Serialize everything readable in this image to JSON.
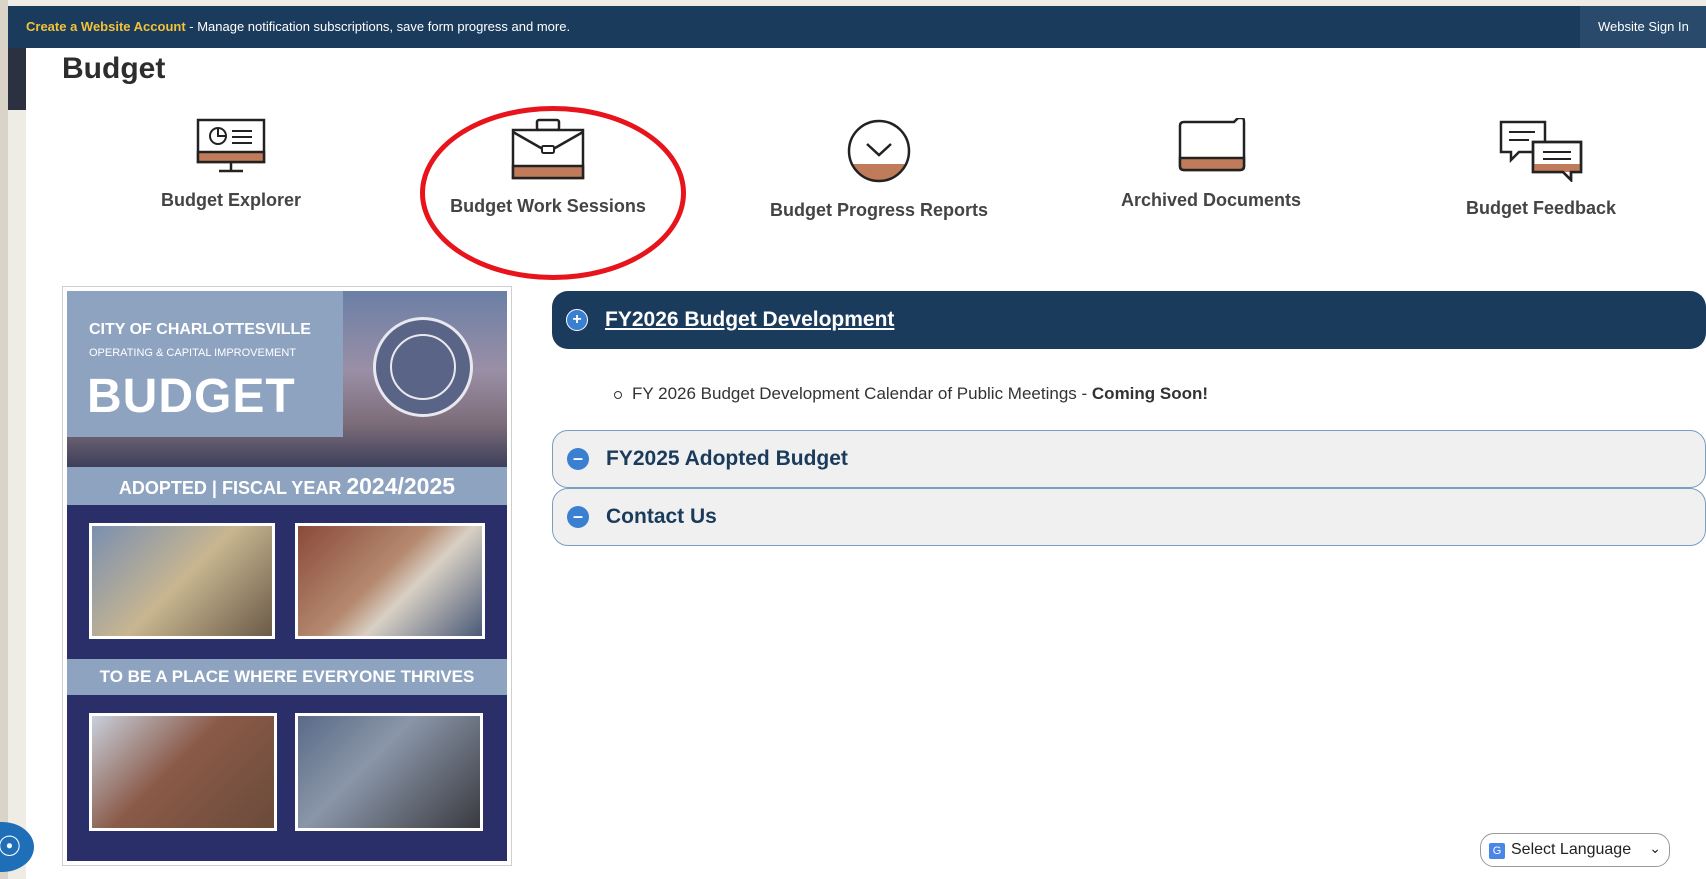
{
  "top_bar": {
    "create_account_link": "Create a Website Account",
    "message": " - Manage notification subscriptions, save form progress and more.",
    "sign_in": "Website Sign In"
  },
  "page": {
    "title": "Budget"
  },
  "nav": [
    {
      "label": "Budget Explorer",
      "icon": "monitor-chart-icon"
    },
    {
      "label": "Budget Work Sessions",
      "icon": "briefcase-icon"
    },
    {
      "label": "Budget Progress Reports",
      "icon": "chevron-circle-icon"
    },
    {
      "label": "Archived Documents",
      "icon": "folder-icon"
    },
    {
      "label": "Budget Feedback",
      "icon": "chat-bubbles-icon"
    }
  ],
  "cover": {
    "city": "CITY OF CHARLOTTESVILLE",
    "subtitle": "OPERATING & CAPITAL IMPROVEMENT",
    "budget": "BUDGET",
    "adopted": "ADOPTED | FISCAL YEAR ",
    "year": "2024/2025",
    "tagline": "TO BE A PLACE WHERE EVERYONE THRIVES"
  },
  "accordion": {
    "open": {
      "title": "FY2026 Budget Development",
      "item_text": "FY 2026 Budget Development Calendar of Public  Meetings  - ",
      "item_status": "Coming Soon!"
    },
    "closed": [
      {
        "title": "FY2025 Adopted Budget"
      },
      {
        "title": "Contact Us"
      }
    ]
  },
  "language": {
    "label": "Select Language"
  },
  "colors": {
    "navy": "#1b3b5c",
    "accent_copper": "#c07c5a",
    "link_gold": "#f3c237",
    "annotation_red": "#e8141c"
  }
}
